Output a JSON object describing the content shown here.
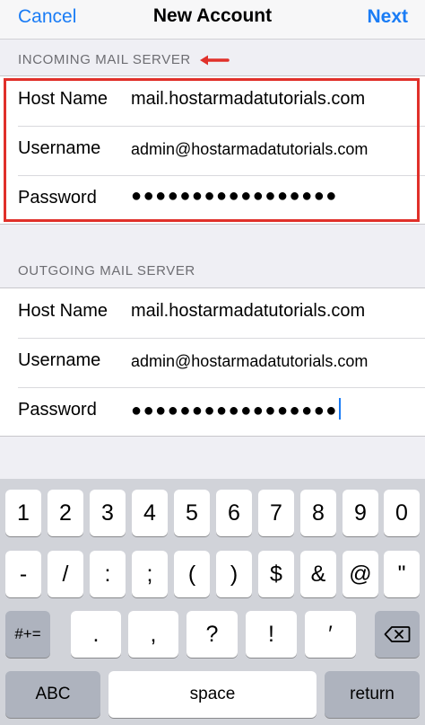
{
  "nav": {
    "cancel": "Cancel",
    "title": "New Account",
    "next": "Next"
  },
  "incoming": {
    "header": "INCOMING MAIL SERVER",
    "rows": [
      {
        "label": "Host Name",
        "value": "mail.hostarmadatutorials.com"
      },
      {
        "label": "Username",
        "value": "admin@hostarmadatutorials.com"
      },
      {
        "label": "Password",
        "value": "●●●●●●●●●●●●●●●●●"
      }
    ]
  },
  "outgoing": {
    "header": "OUTGOING MAIL SERVER",
    "rows": [
      {
        "label": "Host Name",
        "value": "mail.hostarmadatutorials.com"
      },
      {
        "label": "Username",
        "value": "admin@hostarmadatutorials.com"
      },
      {
        "label": "Password",
        "value": "●●●●●●●●●●●●●●●●●"
      }
    ]
  },
  "keyboard": {
    "row1": [
      "1",
      "2",
      "3",
      "4",
      "5",
      "6",
      "7",
      "8",
      "9",
      "0"
    ],
    "row2": [
      "-",
      "/",
      ":",
      ";",
      "(",
      ")",
      "$",
      "&",
      "@",
      "\""
    ],
    "row3": [
      ".",
      ",",
      "?",
      "!",
      "′"
    ],
    "symbols_key": "#+=",
    "abc_key": "ABC",
    "space_key": "space",
    "return_key": "return",
    "delete_icon": "backspace-icon"
  },
  "colors": {
    "accent": "#1a7cf5",
    "highlight": "#e0302a"
  }
}
